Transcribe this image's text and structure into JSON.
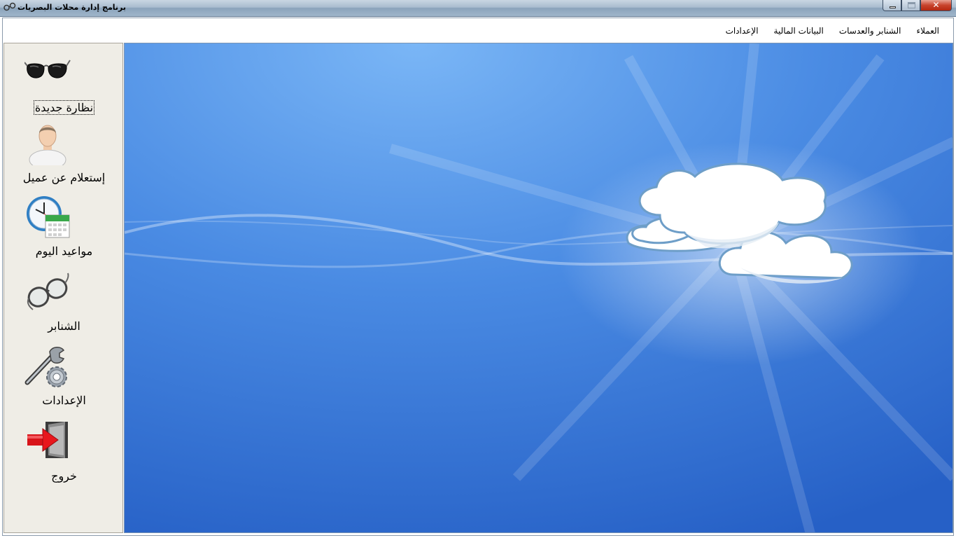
{
  "window": {
    "title": "برنامج إدارة محلات البصريات",
    "icon": "glasses-app-icon",
    "controls": {
      "minimize": "minimize",
      "maximize": "maximize",
      "close": "close"
    }
  },
  "menu": {
    "items": [
      {
        "label": "العملاء"
      },
      {
        "label": "الشنابر والعدسات"
      },
      {
        "label": "البيانات المالية"
      },
      {
        "label": "الإعدادات"
      }
    ]
  },
  "sidebar": {
    "tools": [
      {
        "label": "نظارة جديدة",
        "icon": "sunglasses-icon"
      },
      {
        "label": "إستعلام عن عميل",
        "icon": "user-icon"
      },
      {
        "label": "مواعيد اليوم",
        "icon": "clock-calendar-icon"
      },
      {
        "label": "الشنابر",
        "icon": "eyeglasses-icon"
      },
      {
        "label": "الإعدادات",
        "icon": "wrench-gear-icon"
      },
      {
        "label": "خروج",
        "icon": "exit-door-icon"
      }
    ]
  },
  "wallpaper": {
    "colors": {
      "sky_top": "#6aa8f0",
      "sky_bottom": "#2a63c8",
      "cloud": "#ffffff"
    }
  }
}
